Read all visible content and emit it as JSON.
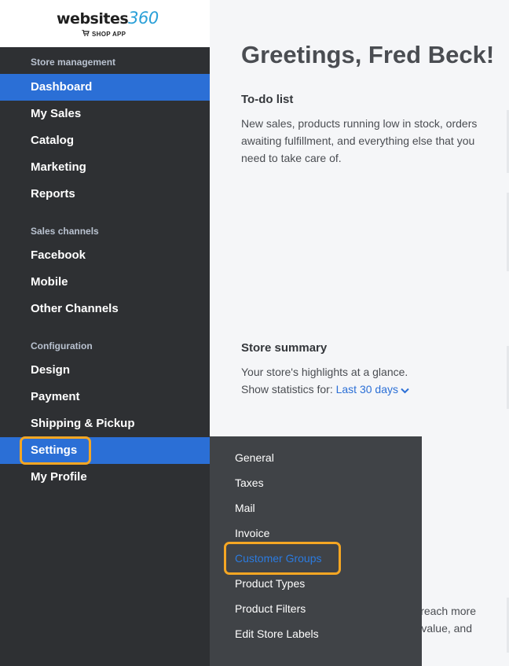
{
  "logo": {
    "text_main": "websites",
    "text_num": "360",
    "subtitle": "SHOP APP"
  },
  "sidebar": {
    "sections": [
      {
        "title": "Store management",
        "items": [
          "Dashboard",
          "My Sales",
          "Catalog",
          "Marketing",
          "Reports"
        ]
      },
      {
        "title": "Sales channels",
        "items": [
          "Facebook",
          "Mobile",
          "Other Channels"
        ]
      },
      {
        "title": "Configuration",
        "items": [
          "Design",
          "Payment",
          "Shipping & Pickup",
          "Settings",
          "My Profile"
        ]
      }
    ],
    "active_item": "Dashboard",
    "highlighted_item": "Settings"
  },
  "main": {
    "greeting": "Greetings, Fred Beck!",
    "todo_title": "To-do list",
    "todo_desc_1": "New sales, products running low in stock, orders",
    "todo_desc_2": "awaiting fulfillment, and everything else that you",
    "todo_desc_3": "need to take care of.",
    "summary_title": "Store summary",
    "summary_desc": "Your store's highlights at a glance.",
    "stats_label": "Show statistics for:",
    "stats_period": "Last 30 days",
    "partial_1": "reach more",
    "partial_2": "value, and"
  },
  "settings_menu": {
    "items": [
      "General",
      "Taxes",
      "Mail",
      "Invoice",
      "Customer Groups",
      "Product Types",
      "Product Filters",
      "Edit Store Labels"
    ],
    "selected_item": "Customer Groups"
  },
  "colors": {
    "accent": "#2b6fd6",
    "highlight": "#f5a623",
    "sidebar_bg": "#2e3033",
    "menu_bg": "#404347"
  }
}
